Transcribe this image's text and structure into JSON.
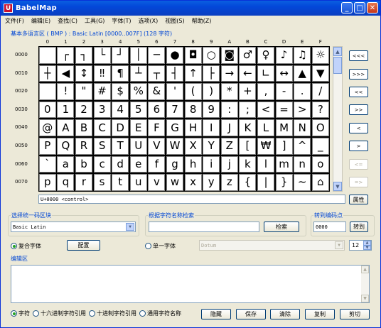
{
  "window": {
    "title": "BabelMap",
    "app_icon_letter": "U",
    "controls": [
      "_",
      "□",
      "✕"
    ]
  },
  "menu": [
    "文件(F)",
    "编辑(E)",
    "查找(C)",
    "工具(G)",
    "字体(T)",
    "选项(X)",
    "视图(S)",
    "帮助(Z)"
  ],
  "block_header": "基本多语言区 ( BMP ) : Basic Latin [0000..007F] (128 字符)",
  "grid": {
    "column_headers": [
      "0",
      "1",
      "2",
      "3",
      "4",
      "5",
      "6",
      "7",
      "8",
      "9",
      "A",
      "B",
      "C",
      "D",
      "E",
      "F"
    ],
    "row_headers": [
      "0000",
      "0010",
      "0020",
      "0030",
      "0040",
      "0050",
      "0060",
      "0070"
    ],
    "rows": [
      [
        "",
        "┌",
        "┐",
        "└",
        "┘",
        "│",
        "─",
        "●",
        "◘",
        "○",
        "◙",
        "♂",
        "♀",
        "♪",
        "♫",
        "☼"
      ],
      [
        "┼",
        "◀",
        "↕",
        "‼",
        "¶",
        "┴",
        "┬",
        "┤",
        "↑",
        "├",
        "→",
        "←",
        "∟",
        "↔",
        "▲",
        "▼"
      ],
      [
        "",
        "!",
        "\"",
        "#",
        "$",
        "%",
        "&",
        "'",
        "(",
        ")",
        "*",
        "+",
        ",",
        "-",
        ".",
        "/"
      ],
      [
        "0",
        "1",
        "2",
        "3",
        "4",
        "5",
        "6",
        "7",
        "8",
        "9",
        ":",
        ";",
        "<",
        "=",
        ">",
        "?"
      ],
      [
        "@",
        "A",
        "B",
        "C",
        "D",
        "E",
        "F",
        "G",
        "H",
        "I",
        "J",
        "K",
        "L",
        "M",
        "N",
        "O"
      ],
      [
        "P",
        "Q",
        "R",
        "S",
        "T",
        "U",
        "V",
        "W",
        "X",
        "Y",
        "Z",
        "[",
        "₩",
        "]",
        "^",
        "_"
      ],
      [
        "`",
        "a",
        "b",
        "c",
        "d",
        "e",
        "f",
        "g",
        "h",
        "i",
        "j",
        "k",
        "l",
        "m",
        "n",
        "o"
      ],
      [
        "p",
        "q",
        "r",
        "s",
        "t",
        "u",
        "v",
        "w",
        "x",
        "y",
        "z",
        "{",
        "|",
        "}",
        "~",
        "⌂"
      ]
    ]
  },
  "nav_buttons": [
    "<<<",
    ">>>",
    "<<",
    ">>",
    "<",
    ">",
    "<=",
    "=>"
  ],
  "char_info": "U+0000 <control>",
  "properties_button": "属性",
  "block_select": {
    "label": "选择统一码区块",
    "value": "Basic Latin"
  },
  "name_search": {
    "label": "根据字符名称检索",
    "value": "",
    "button": "检索"
  },
  "goto_code": {
    "label": "转到编码点",
    "value": "0000",
    "button": "转到"
  },
  "font_mode": {
    "composite_label": "复合字体",
    "config_button": "配置",
    "single_label": "单一字体",
    "font_value": "Dotum",
    "size_value": "12"
  },
  "edit_area": {
    "label": "编辑区",
    "value": ""
  },
  "output_modes": [
    "字符",
    "十六进制字符引用",
    "十进制字符引用",
    "通用字符名称"
  ],
  "action_buttons": [
    "隐藏",
    "保存",
    "清除",
    "复制",
    "剪切"
  ],
  "colors": {
    "title_bar": "#0347d9",
    "group_label": "#0046d5",
    "radio_selected": "#21a121"
  }
}
